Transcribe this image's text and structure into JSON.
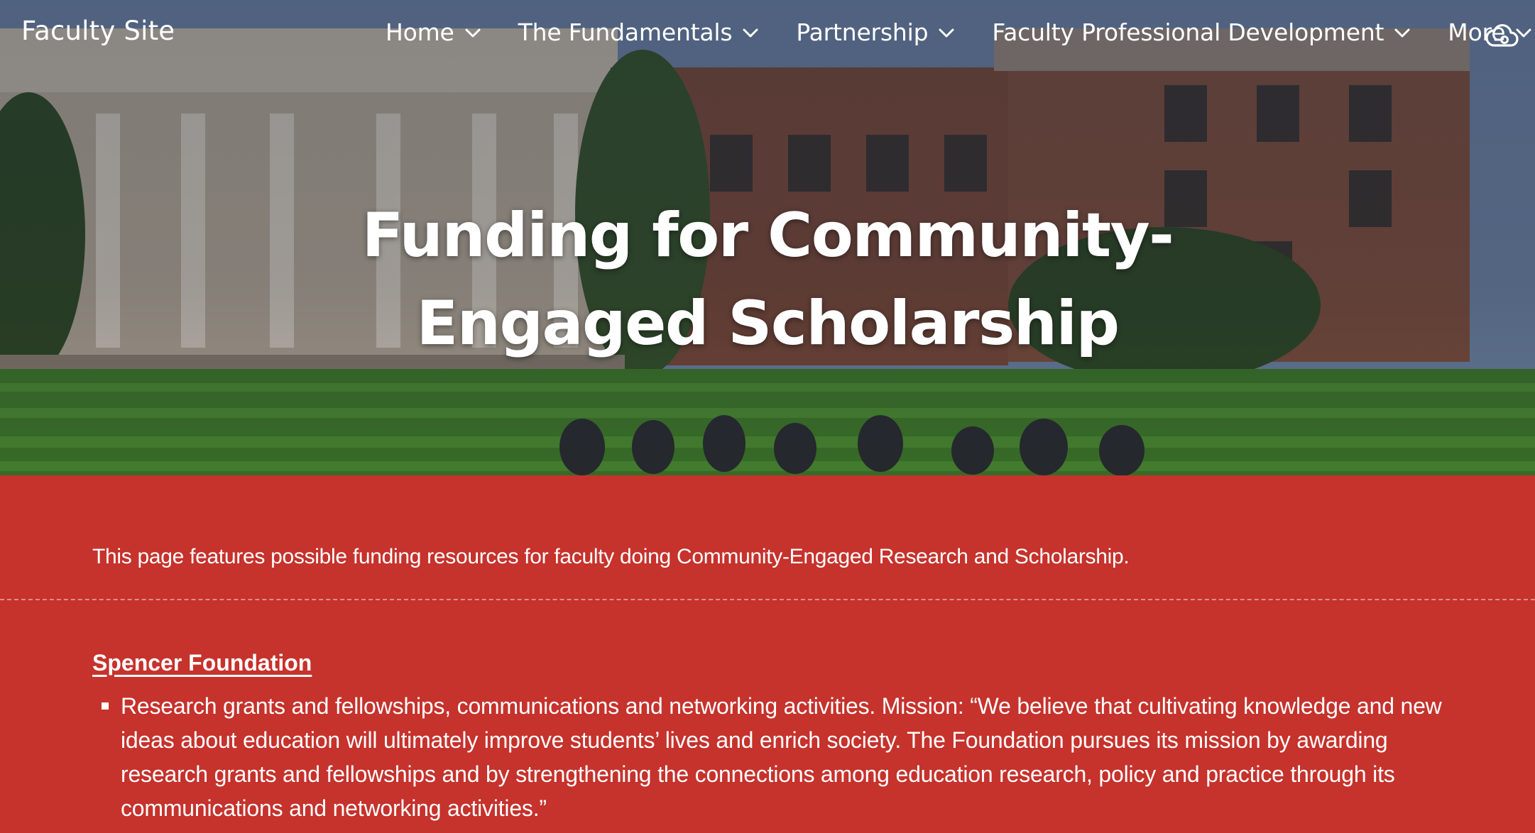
{
  "site": {
    "title": "Faculty Site"
  },
  "nav": {
    "items": [
      {
        "label": "Home"
      },
      {
        "label": "The Fundamentals"
      },
      {
        "label": "Partnership"
      },
      {
        "label": "Faculty Professional Development"
      },
      {
        "label": "More"
      }
    ]
  },
  "hero": {
    "title_line1": "Funding for Community-",
    "title_line2": "Engaged Scholarship"
  },
  "intro": {
    "text": "This page features possible funding resources for faculty doing Community-Engaged Research and Scholarship."
  },
  "sections": [
    {
      "heading": "Spencer Foundation",
      "bullets": [
        "Research grants and fellowships, communications and networking activities. Mission: “We believe that cultivating knowledge and new ideas about education will ultimately improve students’ lives and enrich society. The Foundation pursues its mission by awarding research grants and fellowships and by strengthening the connections among education research, policy and practice through its communications and networking activities.”"
      ]
    }
  ],
  "icons": {
    "nav_chevron": "chevron-down-icon",
    "cloud": "cloud-icon",
    "bullet": "square-bullet-icon"
  },
  "colors": {
    "content_bg": "#c6322c",
    "text": "#ffffff"
  }
}
